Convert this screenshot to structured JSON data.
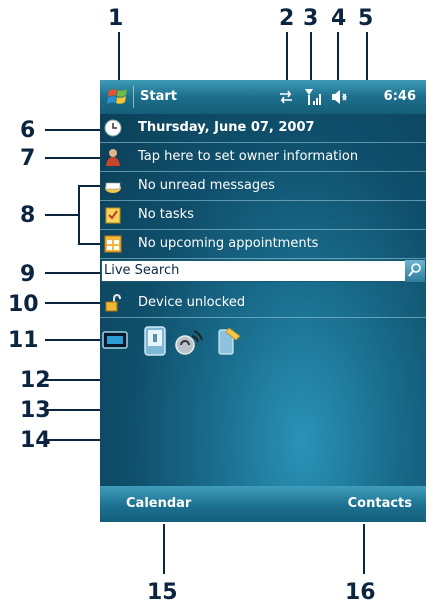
{
  "callouts": [
    "1",
    "2",
    "3",
    "4",
    "5",
    "6",
    "7",
    "8",
    "9",
    "10",
    "11",
    "12",
    "13",
    "14",
    "15",
    "16"
  ],
  "titlebar": {
    "start_label": "Start",
    "clock": "6:46"
  },
  "rows": {
    "date": "Thursday, June 07, 2007",
    "owner": "Tap here to set owner information",
    "messages": "No unread messages",
    "tasks": "No tasks",
    "appointments": "No upcoming appointments",
    "device_lock": "Device unlocked"
  },
  "search": {
    "label": "Live Search"
  },
  "softkeys": {
    "left": "Calendar",
    "right": "Contacts"
  },
  "colors": {
    "background": "#0f4f6b",
    "bars": "#1d6f8c",
    "callout": "#0b2540"
  },
  "icons": [
    "windows-flag-icon",
    "sync-arrows-icon",
    "signal-icon",
    "speaker-icon",
    "clock-icon",
    "owner-icon",
    "mail-icon",
    "task-icon",
    "calendar-icon",
    "search-icon",
    "padlock-icon",
    "wireless-manager-icon",
    "device-icon",
    "connection-icon",
    "pen-icon"
  ]
}
